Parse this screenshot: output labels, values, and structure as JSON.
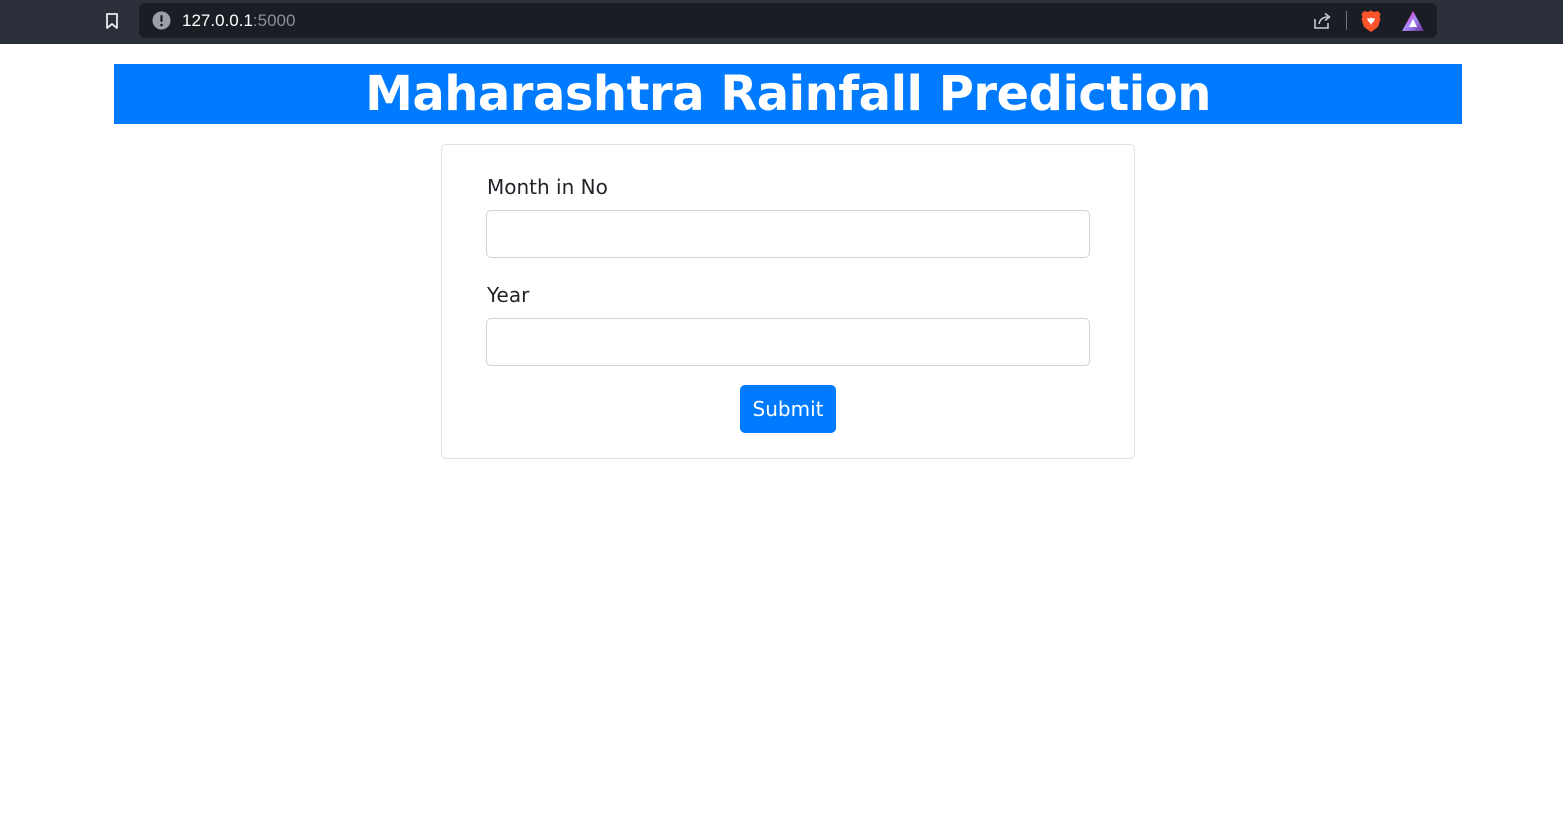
{
  "browser": {
    "url_host": "127.0.0.1",
    "url_port": ":5000",
    "icons": [
      "bookmark-icon",
      "info-icon",
      "share-icon",
      "brave-shield-icon",
      "brave-rewards-icon"
    ]
  },
  "header": {
    "title": "Maharashtra Rainfall Prediction",
    "background": "#007bff"
  },
  "form": {
    "month_label": "Month in No",
    "month_value": "",
    "year_label": "Year",
    "year_value": "",
    "submit_label": "Submit"
  },
  "colors": {
    "accent": "#007bff",
    "browser_chrome": "#2b2f3a",
    "address_bar": "#1b1d25"
  }
}
